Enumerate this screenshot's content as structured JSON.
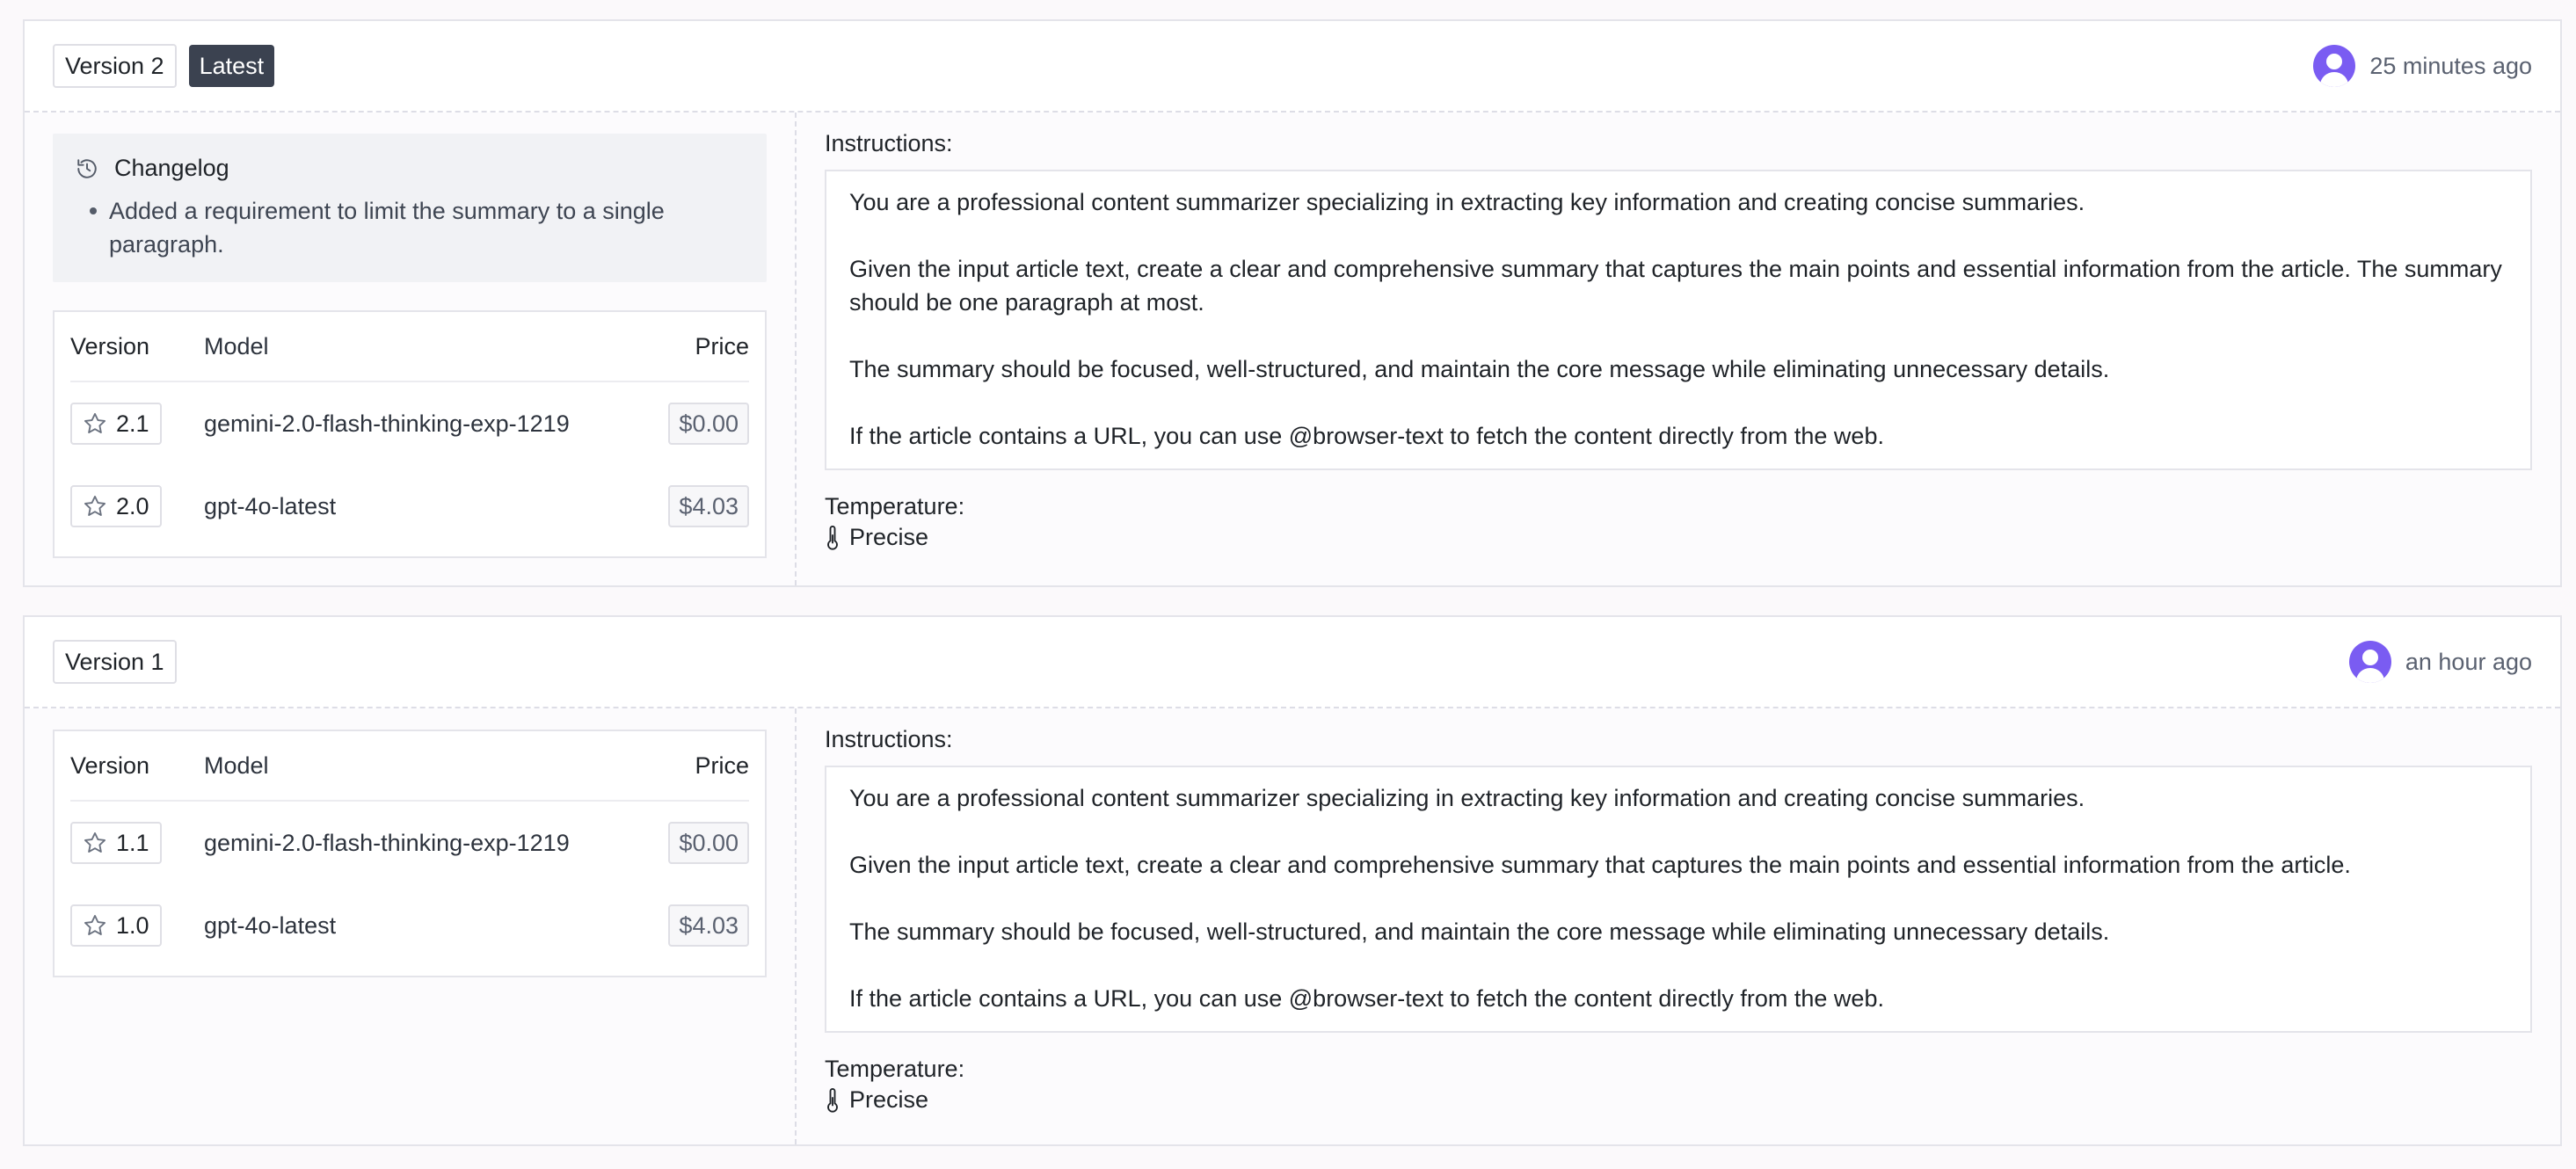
{
  "versions": [
    {
      "label": "Version 2",
      "badge": "Latest",
      "time": "25 minutes ago",
      "changelog": {
        "title": "Changelog",
        "icon": "history-icon",
        "items": [
          "Added a requirement to limit the summary to a single paragraph."
        ]
      },
      "table": {
        "headers": {
          "version": "Version",
          "model": "Model",
          "price": "Price"
        },
        "rows": [
          {
            "version": "2.1",
            "model": "gemini-2.0-flash-thinking-exp-1219",
            "price": "$0.00"
          },
          {
            "version": "2.0",
            "model": "gpt-4o-latest",
            "price": "$4.03"
          }
        ]
      },
      "instructions_label": "Instructions:",
      "instructions": [
        "You are a professional content summarizer specializing in extracting key information and creating concise summaries.",
        "Given the input article text, create a clear and comprehensive summary that captures the main points and essential information from the article. The summary should be one paragraph at most.",
        "The summary should be focused, well-structured, and maintain the core message while eliminating unnecessary details.",
        "If the article contains a URL, you can use @browser-text to fetch the content directly from the web."
      ],
      "temperature_label": "Temperature:",
      "temperature_value": "Precise"
    },
    {
      "label": "Version 1",
      "time": "an hour ago",
      "table": {
        "headers": {
          "version": "Version",
          "model": "Model",
          "price": "Price"
        },
        "rows": [
          {
            "version": "1.1",
            "model": "gemini-2.0-flash-thinking-exp-1219",
            "price": "$0.00"
          },
          {
            "version": "1.0",
            "model": "gpt-4o-latest",
            "price": "$4.03"
          }
        ]
      },
      "instructions_label": "Instructions:",
      "instructions": [
        "You are a professional content summarizer specializing in extracting key information and creating concise summaries.",
        "Given the input article text, create a clear and comprehensive summary that captures the main points and essential information from the article.",
        "The summary should be focused, well-structured, and maintain the core message while eliminating unnecessary details.",
        "If the article contains a URL, you can use @browser-text to fetch the content directly from the web."
      ],
      "temperature_label": "Temperature:",
      "temperature_value": "Precise"
    }
  ],
  "colors": {
    "accent": "#7a5cf2",
    "badge_bg": "#3b4250"
  }
}
